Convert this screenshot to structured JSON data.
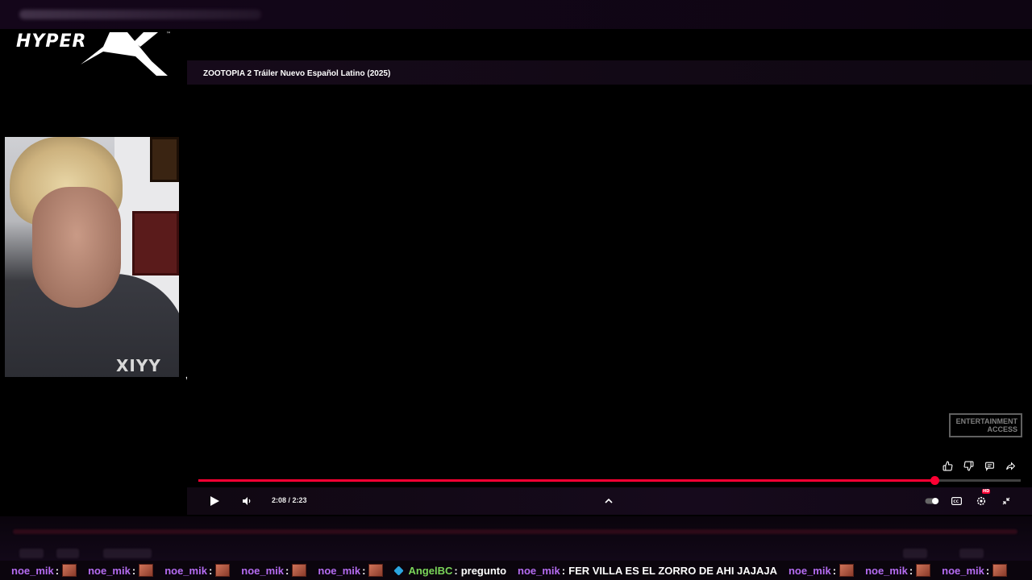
{
  "brand": {
    "logo_text": "HYPERX",
    "trademark": "™"
  },
  "webcam": {
    "shirt_text": "XIYY"
  },
  "player": {
    "video_title": "ZOOTOPIA 2 Tráiler Nuevo Español Latino (2025)",
    "watermark": {
      "line1": "ENTERTAINMENT",
      "line2": "ACCESS"
    },
    "current_time": "2:08",
    "duration": "2:23",
    "time_display": "2:08 / 2:23",
    "progress_fraction": 0.895,
    "quality_badge": "HD",
    "icons": {
      "play": "play-icon",
      "volume": "volume-icon",
      "chevron": "chevron-up-icon",
      "autoplay": "autoplay-toggle-icon",
      "captions": "captions-icon",
      "settings": "settings-icon",
      "exit_fullscreen": "exit-fullscreen-icon",
      "like": "thumbs-up-icon",
      "dislike": "thumbs-down-icon",
      "comments": "comment-icon",
      "share": "share-icon"
    },
    "colors": {
      "progress": "#ff0033",
      "background": "#000000"
    }
  },
  "chat": {
    "messages": [
      {
        "user": "noe_mik",
        "emote": true
      },
      {
        "user": "noe_mik",
        "emote": true
      },
      {
        "user": "noe_mik",
        "emote": true
      },
      {
        "user": "noe_mik",
        "emote": true
      },
      {
        "user": "noe_mik",
        "emote": true
      },
      {
        "user": "AngelBC",
        "text": "pregunto"
      },
      {
        "user": "noe_mik",
        "text": "FER VILLA ES EL ZORRO DE AHI JAJAJA"
      },
      {
        "user": "noe_mik",
        "emote": true
      },
      {
        "user": "noe_mik",
        "emote": true
      },
      {
        "user": "noe_mik",
        "emote": true
      }
    ],
    "colors": {
      "username": "#b56cf2",
      "username_alt": "#7bd65a"
    }
  }
}
